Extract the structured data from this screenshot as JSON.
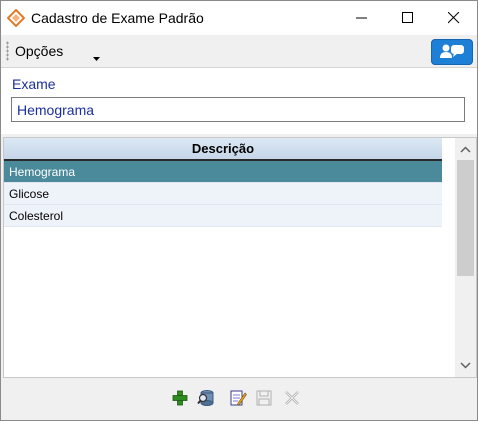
{
  "window": {
    "title": "Cadastro de Exame Padrão"
  },
  "toolbar": {
    "menu_label": "Opções"
  },
  "form": {
    "exame_label": "Exame",
    "exame_value": "Hemograma"
  },
  "grid": {
    "column_header": "Descrição",
    "rows": [
      "Hemograma",
      "Glicose",
      "Colesterol"
    ],
    "selected_row": "Hemograma"
  },
  "colors": {
    "selected_row": "#4a8a9a",
    "label_blue": "#1a2fa0",
    "help_button": "#1e7fd6"
  },
  "icons": {
    "add": "plus-icon",
    "search": "search-db-icon",
    "edit": "edit-icon",
    "save": "save-icon",
    "delete": "delete-icon"
  }
}
